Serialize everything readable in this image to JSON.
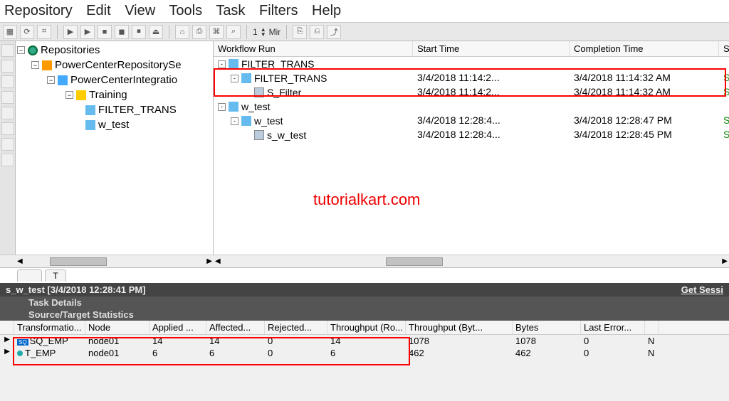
{
  "menu": {
    "repository": "Repository",
    "edit": "Edit",
    "view": "View",
    "tools": "Tools",
    "task": "Task",
    "filters": "Filters",
    "help": "Help"
  },
  "toolbar": {
    "spinner_value": "1",
    "spinner_unit": "Mir"
  },
  "tree": {
    "root": "Repositories",
    "repo": "PowerCenterRepositorySe",
    "integration": "PowerCenterIntegratio",
    "folder": "Training",
    "wf1": "FILTER_TRANS",
    "wf2": "w_test"
  },
  "grid": {
    "columns": {
      "run": "Workflow Run",
      "start": "Start Time",
      "completion": "Completion Time",
      "status": "Status"
    },
    "rows": [
      {
        "name": "FILTER_TRANS",
        "start": "",
        "completion": "",
        "status": "",
        "indent": 0,
        "icon": "wf",
        "exp": "-"
      },
      {
        "name": "FILTER_TRANS",
        "start": "3/4/2018 11:14:2...",
        "completion": "3/4/2018 11:14:32 AM",
        "status": "Succeeded",
        "indent": 1,
        "icon": "wf",
        "exp": "-"
      },
      {
        "name": "S_Filter",
        "start": "3/4/2018 11:14:2...",
        "completion": "3/4/2018 11:14:32 AM",
        "status": "Succeeded",
        "indent": 2,
        "icon": "task",
        "exp": ""
      },
      {
        "name": "w_test",
        "start": "",
        "completion": "",
        "status": "",
        "indent": 0,
        "icon": "wf",
        "exp": "-"
      },
      {
        "name": "w_test",
        "start": "3/4/2018 12:28:4...",
        "completion": "3/4/2018 12:28:47 PM",
        "status": "Succeeded",
        "indent": 1,
        "icon": "wf",
        "exp": "-"
      },
      {
        "name": "s_w_test",
        "start": "3/4/2018 12:28:4...",
        "completion": "3/4/2018 12:28:45 PM",
        "status": "Succeeded",
        "indent": 2,
        "icon": "task",
        "exp": ""
      }
    ]
  },
  "watermark": "tutorialkart.com",
  "tabs": {
    "a": "",
    "b": "T"
  },
  "session": {
    "title": "s_w_test [3/4/2018 12:28:41 PM]",
    "action": "Get Sessi",
    "task_details": "Task Details",
    "stats_title": "Source/Target Statistics"
  },
  "stats": {
    "columns": {
      "transform": "Transformatio...",
      "node": "Node",
      "applied": "Applied ...",
      "affected": "Affected...",
      "rejected": "Rejected...",
      "thr_rows": "Throughput (Ro...",
      "thr_bytes": "Throughput (Byt...",
      "bytes": "Bytes",
      "last_err": "Last Error..."
    },
    "rows": [
      {
        "name": "SQ_EMP",
        "node": "node01",
        "applied": "14",
        "affected": "14",
        "rejected": "0",
        "thr_rows": "14",
        "thr_bytes": "1078",
        "bytes": "1078",
        "last_err": "0",
        "tail": "N"
      },
      {
        "name": "T_EMP",
        "node": "node01",
        "applied": "6",
        "affected": "6",
        "rejected": "0",
        "thr_rows": "6",
        "thr_bytes": "462",
        "bytes": "462",
        "last_err": "0",
        "tail": "N"
      }
    ]
  }
}
